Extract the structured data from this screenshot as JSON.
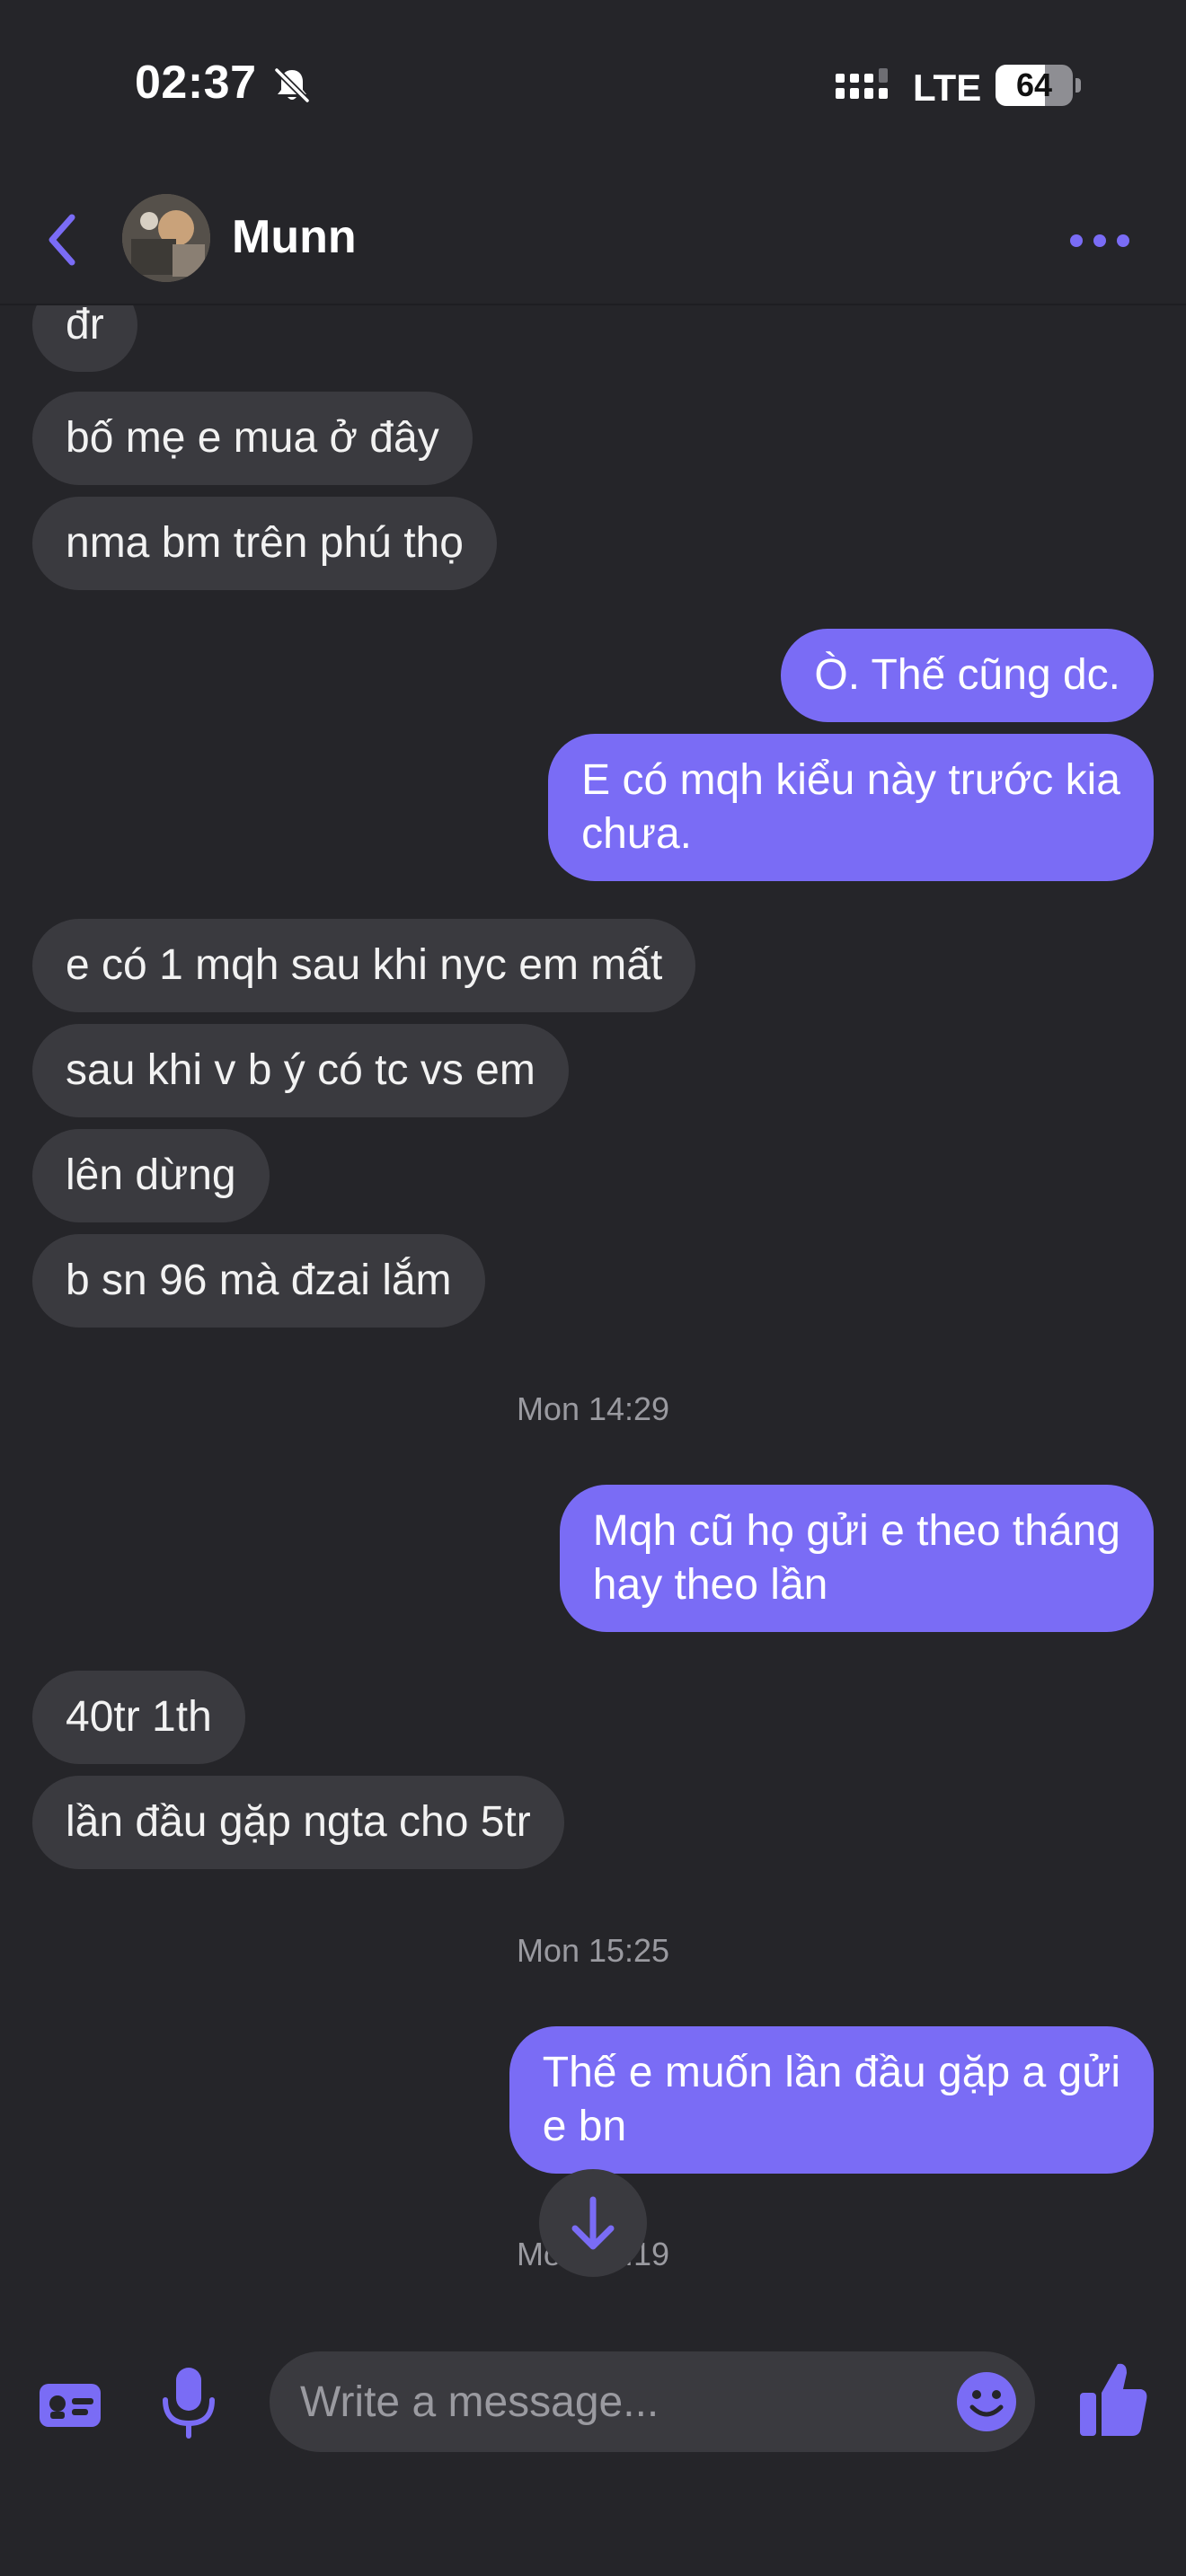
{
  "status_bar": {
    "time": "02:37",
    "network": "LTE",
    "battery": "64"
  },
  "header": {
    "contact_name": "Munn"
  },
  "messages": [
    {
      "text": "đr"
    },
    {
      "text": "bố mẹ e mua ở đây"
    },
    {
      "text": "nma bm trên phú thọ"
    },
    {
      "text": "Ò. Thế cũng dc."
    },
    {
      "text": "E có mqh kiểu này trước kia\nchưa."
    },
    {
      "text": "e có 1 mqh sau khi nyc em mất"
    },
    {
      "text": "sau khi v b ý có tc vs em"
    },
    {
      "text": "lên dừng"
    },
    {
      "text": "b sn 96 mà đzai lắm"
    },
    {
      "text": "Mqh cũ họ gửi e theo tháng\nhay theo lần"
    },
    {
      "text": "40tr 1th"
    },
    {
      "text": "lần đầu gặp ngta cho 5tr"
    },
    {
      "text": "Thế e muốn lần đầu gặp a gửi\ne bn"
    }
  ],
  "timestamps": [
    "Mon 14:29",
    "Mon 15:25",
    "Mon 16:19"
  ],
  "composer": {
    "placeholder": "Write a message..."
  },
  "colors": {
    "accent": "#7a6cf5",
    "background": "#252529",
    "incoming_bubble": "#3a3a3f"
  },
  "icons": [
    "bell-slash-icon",
    "signal-icon",
    "battery-icon",
    "back-chevron-icon",
    "more-dots-icon",
    "arrow-down-icon",
    "contact-card-icon",
    "microphone-icon",
    "smiley-icon",
    "thumbs-up-icon"
  ]
}
